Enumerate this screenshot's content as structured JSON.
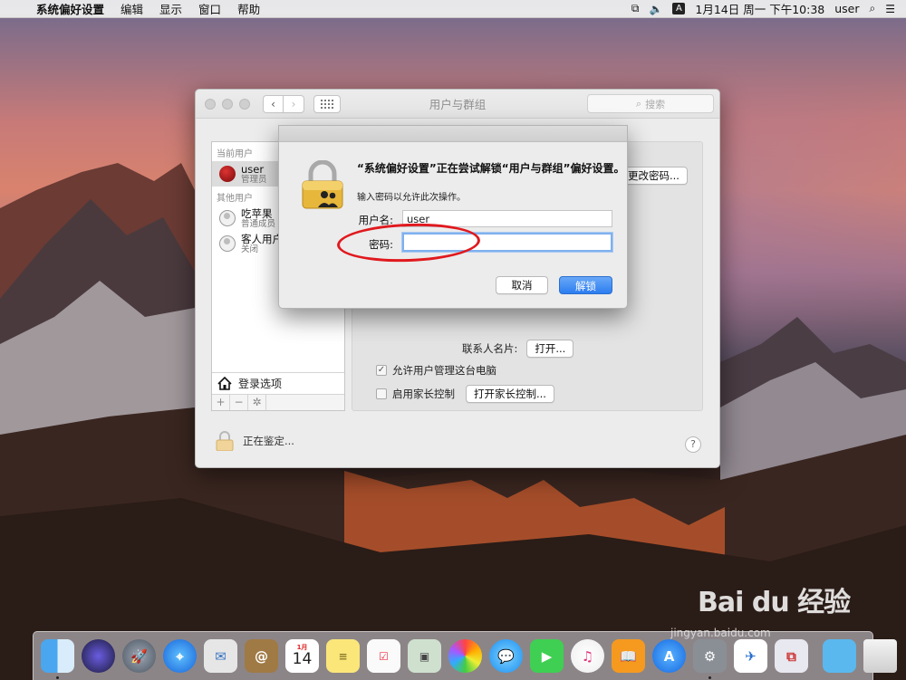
{
  "menubar": {
    "app": "系统偏好设置",
    "items": [
      "编辑",
      "显示",
      "窗口",
      "帮助"
    ],
    "input_indicator": "A",
    "clock": "1月14日 周一 下午10:38",
    "user": "user"
  },
  "window": {
    "title": "用户与群组",
    "search_placeholder": "搜索",
    "sidebar": {
      "current_users_header": "当前用户",
      "current_user": {
        "name": "user",
        "role": "管理员"
      },
      "other_users_header": "其他用户",
      "other_users": [
        {
          "name": "吃苹果",
          "role": "普通成员"
        },
        {
          "name": "客人用户",
          "role": "关闭"
        }
      ],
      "login_options": "登录选项",
      "add": "+",
      "remove": "−"
    },
    "content": {
      "change_password_button": "更改密码...",
      "contact_card_label": "联系人名片:",
      "open_button": "打开...",
      "allow_admin_label": "允许用户管理这台电脑",
      "parental_label": "启用家长控制",
      "open_parental_button": "打开家长控制..."
    },
    "status_text": "正在鉴定...",
    "help": "?"
  },
  "dialog": {
    "message": "“系统偏好设置”正在尝试解锁“用户与群组”偏好设置。",
    "sub": "输入密码以允许此次操作。",
    "username_label": "用户名:",
    "username_value": "user",
    "password_label": "密码:",
    "password_value": "",
    "cancel": "取消",
    "unlock": "解锁"
  },
  "dock": {
    "calendar_month": "1月",
    "calendar_day": "14"
  },
  "watermark": {
    "brand": "Bai du 经验",
    "url": "jingyan.baidu.com"
  }
}
